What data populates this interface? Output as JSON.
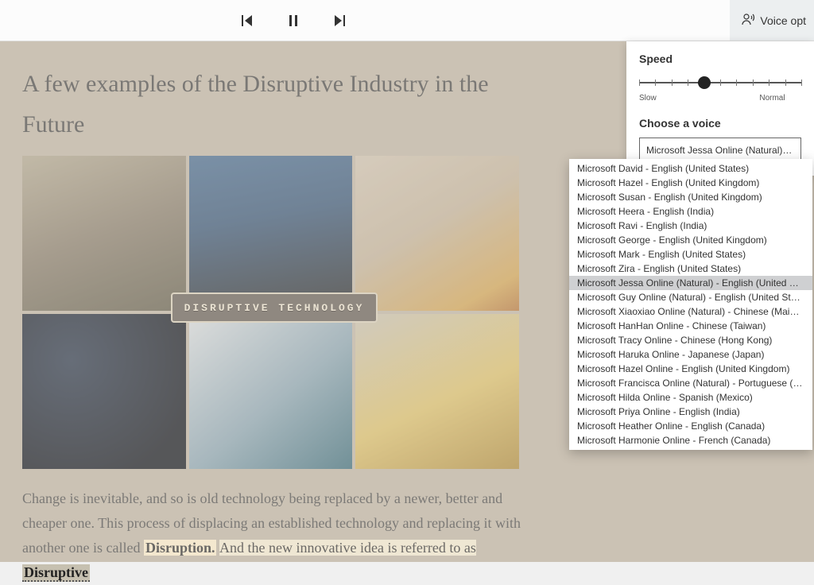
{
  "toolbar": {
    "voice_options_label": "Voice opt"
  },
  "article": {
    "heading": "A few examples of the Disruptive Industry in the Future",
    "banner": "DISRUPTIVE TECHNOLOGY",
    "p1_a": "Change is inevitable, and so is old technology being replaced by a newer, better and cheaper one. This process of displacing an established technology and replacing it with another one is called ",
    "p1_b": "Disruption.",
    "p1_c": " And the new innovative idea is referred to as ",
    "p1_d": "Disruptive"
  },
  "panel": {
    "speed_label": "Speed",
    "slider_min_label": "Slow",
    "slider_mid_label": "Normal",
    "choose_label": "Choose a voice",
    "selected_voice": "Microsoft Jessa Online (Natural) - Engl",
    "voices": [
      "Microsoft David - English (United States)",
      "Microsoft Hazel - English (United Kingdom)",
      "Microsoft Susan - English (United Kingdom)",
      "Microsoft Heera - English (India)",
      "Microsoft Ravi - English (India)",
      "Microsoft George - English (United Kingdom)",
      "Microsoft Mark - English (United States)",
      "Microsoft Zira - English (United States)",
      "Microsoft Jessa Online (Natural) - English (United States)",
      "Microsoft Guy Online (Natural) - English (United States)",
      "Microsoft Xiaoxiao Online (Natural) - Chinese (Mainland",
      "Microsoft HanHan Online - Chinese (Taiwan)",
      "Microsoft Tracy Online - Chinese (Hong Kong)",
      "Microsoft Haruka Online - Japanese (Japan)",
      "Microsoft Hazel Online - English (United Kingdom)",
      "Microsoft Francisca Online (Natural) - Portuguese (Brazil",
      "Microsoft Hilda Online - Spanish (Mexico)",
      "Microsoft Priya Online - English (India)",
      "Microsoft Heather Online - English (Canada)",
      "Microsoft Harmonie Online - French (Canada)"
    ],
    "selected_index": 8
  }
}
